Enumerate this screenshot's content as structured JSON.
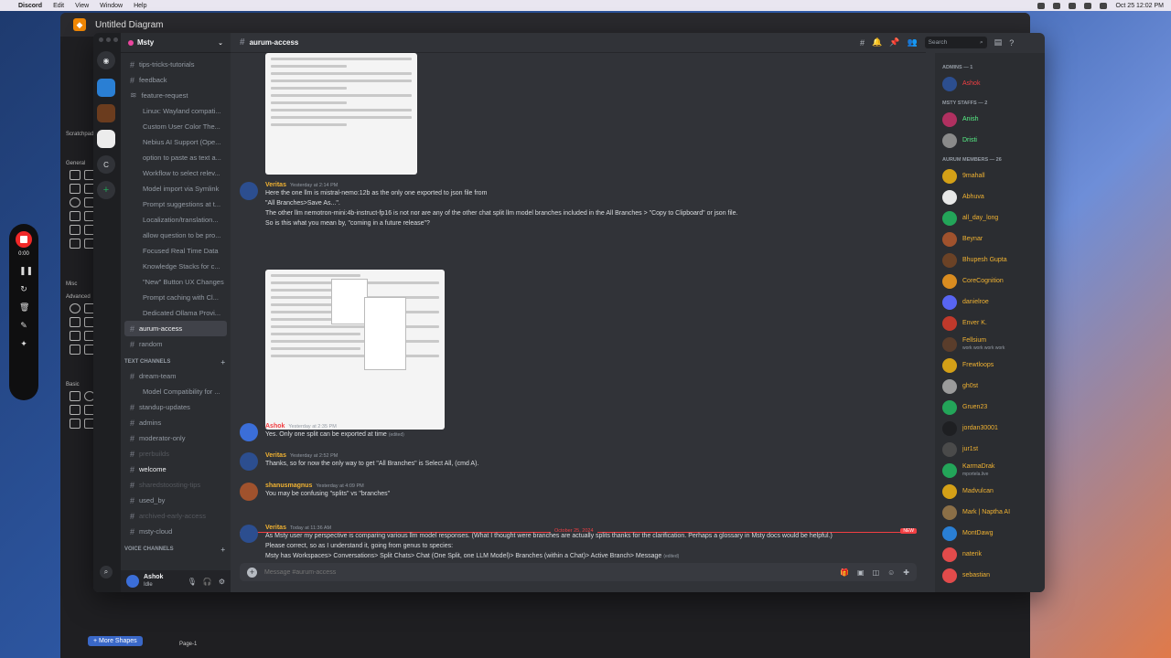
{
  "menubar": {
    "app": "Discord",
    "items": [
      "Edit",
      "View",
      "Window",
      "Help"
    ],
    "clock": "Oct 25  12:02 PM"
  },
  "diagram": {
    "title": "Untitled Diagram",
    "sections": [
      "Scratchpad",
      "General",
      "Misc",
      "Advanced",
      "Basic"
    ],
    "more_shapes": "+ More Shapes",
    "page_tab": "Page-1"
  },
  "recorder": {
    "time": "0:00"
  },
  "discord": {
    "server_name": "Msty",
    "channels_top": [
      {
        "name": "tips-tricks-tutorials",
        "kind": "channel"
      },
      {
        "name": "feedback",
        "kind": "channel"
      },
      {
        "name": "feature-request",
        "kind": "forum"
      },
      {
        "name": "Linux: Wayland compati...",
        "kind": "thread"
      },
      {
        "name": "Custom User Color The...",
        "kind": "thread"
      },
      {
        "name": "Nebius AI Support (Ope...",
        "kind": "thread"
      },
      {
        "name": "option to paste as text a...",
        "kind": "thread"
      },
      {
        "name": "Workflow to select relev...",
        "kind": "thread"
      },
      {
        "name": "Model import via Symlink",
        "kind": "thread"
      },
      {
        "name": "Prompt suggestions at t...",
        "kind": "thread"
      },
      {
        "name": "Localization/translation...",
        "kind": "thread"
      },
      {
        "name": "allow question to be pro...",
        "kind": "thread"
      },
      {
        "name": "Focused Real Time Data",
        "kind": "thread"
      },
      {
        "name": "Knowledge Stacks for c...",
        "kind": "thread"
      },
      {
        "name": "\"New\" Button UX Changes",
        "kind": "thread"
      },
      {
        "name": "Prompt caching with Cl...",
        "kind": "thread"
      },
      {
        "name": "Dedicated Ollama Provi...",
        "kind": "thread"
      },
      {
        "name": "aurum-access",
        "kind": "channel",
        "active": true
      },
      {
        "name": "random",
        "kind": "channel"
      }
    ],
    "text_channels_label": "TEXT CHANNELS",
    "channels_text": [
      {
        "name": "dream-team",
        "kind": "channel"
      },
      {
        "name": "Model Compatibility for ...",
        "kind": "thread"
      },
      {
        "name": "standup-updates",
        "kind": "channel"
      },
      {
        "name": "admins",
        "kind": "channel"
      },
      {
        "name": "moderator-only",
        "kind": "channel"
      },
      {
        "name": "prerbuilds",
        "kind": "channel",
        "dim": true
      },
      {
        "name": "welcome",
        "kind": "channel",
        "bold": true
      },
      {
        "name": "sharedstoosting-tips",
        "kind": "channel",
        "dim": true
      },
      {
        "name": "used_by",
        "kind": "channel"
      },
      {
        "name": "archived-early-access",
        "kind": "channel",
        "dim": true
      },
      {
        "name": "msty-cloud",
        "kind": "channel"
      }
    ],
    "voice_channels_label": "VOICE CHANNELS",
    "user": {
      "name": "Ashok",
      "status": "Idle"
    },
    "current_channel": "aurum-access",
    "search_placeholder": "Search",
    "messages": [
      {
        "author": "Veritas",
        "color": "#f0b232",
        "time": "Yesterday at 2:14 PM",
        "lines": [
          "Here the one llm is mistral-nemo:12b as the only one exported to json file from",
          "\"All Branches>Save As...\".",
          " The other llm nemotron-mini:4b-instruct-fp16 is not nor are any of the other chat split llm model branches included in the All Branches > \"Copy to Clipboard\" or json file.",
          "So is this what you mean by, \"coming in a future release\"?"
        ]
      },
      {
        "author": "Ashok",
        "color": "#f23f43",
        "time": "Yesterday at 2:35 PM",
        "lines": [
          "Yes. Only one split can be exported at time"
        ],
        "edited": "(edited)"
      },
      {
        "author": "Veritas",
        "color": "#f0b232",
        "time": "Yesterday at 2:52 PM",
        "lines": [
          "Thanks, so for now the only way to get \"All Branches\" is Select All, (cmd A)."
        ]
      },
      {
        "author": "shanusmagnus",
        "color": "#f0b232",
        "time": "Yesterday at 4:09 PM",
        "lines": [
          "You may be confusing \"splits\" vs \"branches\""
        ]
      },
      {
        "author": "Veritas",
        "color": "#f0b232",
        "time": "Today at 11:36 AM",
        "lines": [
          "As Msty user my perspective is comparing various llm model responses. (What I thought were branches are actually splits thanks for the clarification. Perhaps a glossary in Msty docs would be helpful.)",
          "Please correct, so as I understand it, going from genus to species:",
          "Msty has Workspaces> Conversations> Split Chats> Chat (One Split, one LLM Model)> Branches (within a Chat)> Active Branch> Message"
        ],
        "edited": "(edited)"
      }
    ],
    "divider_date": "October 25, 2024",
    "divider_new": "NEW",
    "composer_placeholder": "Message #aurum-access",
    "member_groups": [
      {
        "label": "ADMINS — 1",
        "members": [
          {
            "name": "Ashok",
            "color": "#f23f43"
          }
        ]
      },
      {
        "label": "MSTY STAFFS — 2",
        "members": [
          {
            "name": "Anish",
            "color": "#57f287"
          },
          {
            "name": "Dristi",
            "color": "#57f287"
          }
        ]
      },
      {
        "label": "AURUM MEMBERS — 26",
        "members": [
          {
            "name": "9mahall",
            "color": "#f0b232"
          },
          {
            "name": "Abhuva",
            "color": "#f0b232"
          },
          {
            "name": "all_day_long",
            "color": "#f0b232"
          },
          {
            "name": "Beynar",
            "color": "#f0b232"
          },
          {
            "name": "Bhupesh Gupta",
            "color": "#f0b232"
          },
          {
            "name": "CoreCognition",
            "color": "#f0b232"
          },
          {
            "name": "danielroe",
            "color": "#f0b232"
          },
          {
            "name": "Enver K.",
            "color": "#f0b232"
          },
          {
            "name": "Fellsium",
            "color": "#f0b232",
            "status": "work work work work"
          },
          {
            "name": "Frewtloops",
            "color": "#f0b232"
          },
          {
            "name": "gh0st",
            "color": "#f0b232"
          },
          {
            "name": "Gruen23",
            "color": "#f0b232"
          },
          {
            "name": "jordan30001",
            "color": "#f0b232"
          },
          {
            "name": "jur1st",
            "color": "#f0b232"
          },
          {
            "name": "KarmaDrak",
            "color": "#f0b232",
            "status": "mportela.live"
          },
          {
            "name": "Madvulcan",
            "color": "#f0b232"
          },
          {
            "name": "Mark | Naptha AI",
            "color": "#f0b232"
          },
          {
            "name": "MontDawg",
            "color": "#f0b232"
          },
          {
            "name": "naterik",
            "color": "#f0b232"
          },
          {
            "name": "sebastian",
            "color": "#f0b232"
          }
        ]
      }
    ]
  }
}
